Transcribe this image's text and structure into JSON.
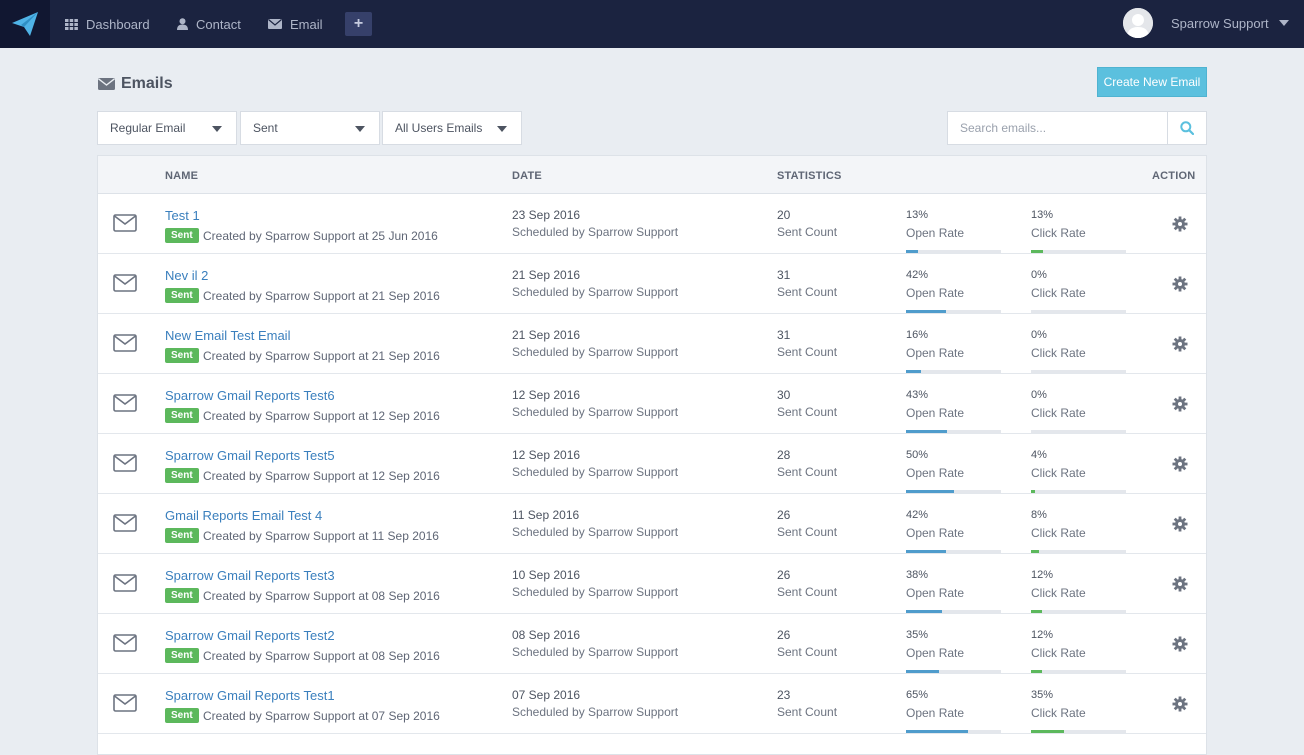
{
  "nav": {
    "logo_icon": "paper-plane-icon",
    "items": [
      {
        "label": "Dashboard",
        "icon": "grid-icon"
      },
      {
        "label": "Contact",
        "icon": "user-icon"
      },
      {
        "label": "Email",
        "icon": "envelope-icon"
      }
    ],
    "plus_label": "+",
    "user_name": "Sparrow Support"
  },
  "header": {
    "title": "Emails",
    "create_button": "Create New Email"
  },
  "filters": {
    "type": "Regular Email",
    "status": "Sent",
    "users": "All Users Emails",
    "search_placeholder": "Search emails..."
  },
  "table": {
    "headers": {
      "name": "NAME",
      "date": "DATE",
      "statistics": "STATISTICS",
      "action": "ACTION"
    },
    "open_label": "Open Rate",
    "click_label": "Click Rate",
    "sent_count_label": "Sent Count",
    "badge": "Sent",
    "rows": [
      {
        "name": "Test 1",
        "created": "Created by Sparrow Support at 25 Jun 2016",
        "date": "23 Sep 2016",
        "scheduled": "Scheduled by Sparrow Support",
        "sent": "20",
        "open": "13%",
        "click": "13%",
        "open_pct": 13,
        "click_pct": 13
      },
      {
        "name": "Nev                             il 2",
        "created": "Created by Sparrow Support at 21 Sep 2016",
        "date": "21 Sep 2016",
        "scheduled": "Scheduled by Sparrow Support",
        "sent": "31",
        "open": "42%",
        "click": "0%",
        "open_pct": 42,
        "click_pct": 0
      },
      {
        "name": "New Email Test Email",
        "created": "Created by Sparrow Support at 21 Sep 2016",
        "date": "21 Sep 2016",
        "scheduled": "Scheduled by Sparrow Support",
        "sent": "31",
        "open": "16%",
        "click": "0%",
        "open_pct": 16,
        "click_pct": 0
      },
      {
        "name": "Sparrow Gmail Reports Test6",
        "created": "Created by Sparrow Support at 12 Sep 2016",
        "date": "12 Sep 2016",
        "scheduled": "Scheduled by Sparrow Support",
        "sent": "30",
        "open": "43%",
        "click": "0%",
        "open_pct": 43,
        "click_pct": 0
      },
      {
        "name": "Sparrow Gmail Reports Test5",
        "created": "Created by Sparrow Support at 12 Sep 2016",
        "date": "12 Sep 2016",
        "scheduled": "Scheduled by Sparrow Support",
        "sent": "28",
        "open": "50%",
        "click": "4%",
        "open_pct": 50,
        "click_pct": 4
      },
      {
        "name": "Gmail Reports Email Test 4",
        "created": "Created by Sparrow Support at 11 Sep 2016",
        "date": "11 Sep 2016",
        "scheduled": "Scheduled by Sparrow Support",
        "sent": "26",
        "open": "42%",
        "click": "8%",
        "open_pct": 42,
        "click_pct": 8
      },
      {
        "name": "Sparrow Gmail Reports Test3",
        "created": "Created by Sparrow Support at 08 Sep 2016",
        "date": "10 Sep 2016",
        "scheduled": "Scheduled by Sparrow Support",
        "sent": "26",
        "open": "38%",
        "click": "12%",
        "open_pct": 38,
        "click_pct": 12
      },
      {
        "name": "Sparrow Gmail Reports Test2",
        "created": "Created by Sparrow Support at 08 Sep 2016",
        "date": "08 Sep 2016",
        "scheduled": "Scheduled by Sparrow Support",
        "sent": "26",
        "open": "35%",
        "click": "12%",
        "open_pct": 35,
        "click_pct": 12
      },
      {
        "name": "Sparrow Gmail Reports Test1",
        "created": "Created by Sparrow Support at 07 Sep 2016",
        "date": "07 Sep 2016",
        "scheduled": "Scheduled by Sparrow Support",
        "sent": "23",
        "open": "65%",
        "click": "35%",
        "open_pct": 65,
        "click_pct": 35
      }
    ]
  },
  "colors": {
    "topbar": "#1b2340",
    "accent": "#5bc0de",
    "link": "#3a7fbd",
    "badge": "#5cb85c",
    "open_bar": "#4f9ccc",
    "click_bar": "#5cb85c"
  }
}
